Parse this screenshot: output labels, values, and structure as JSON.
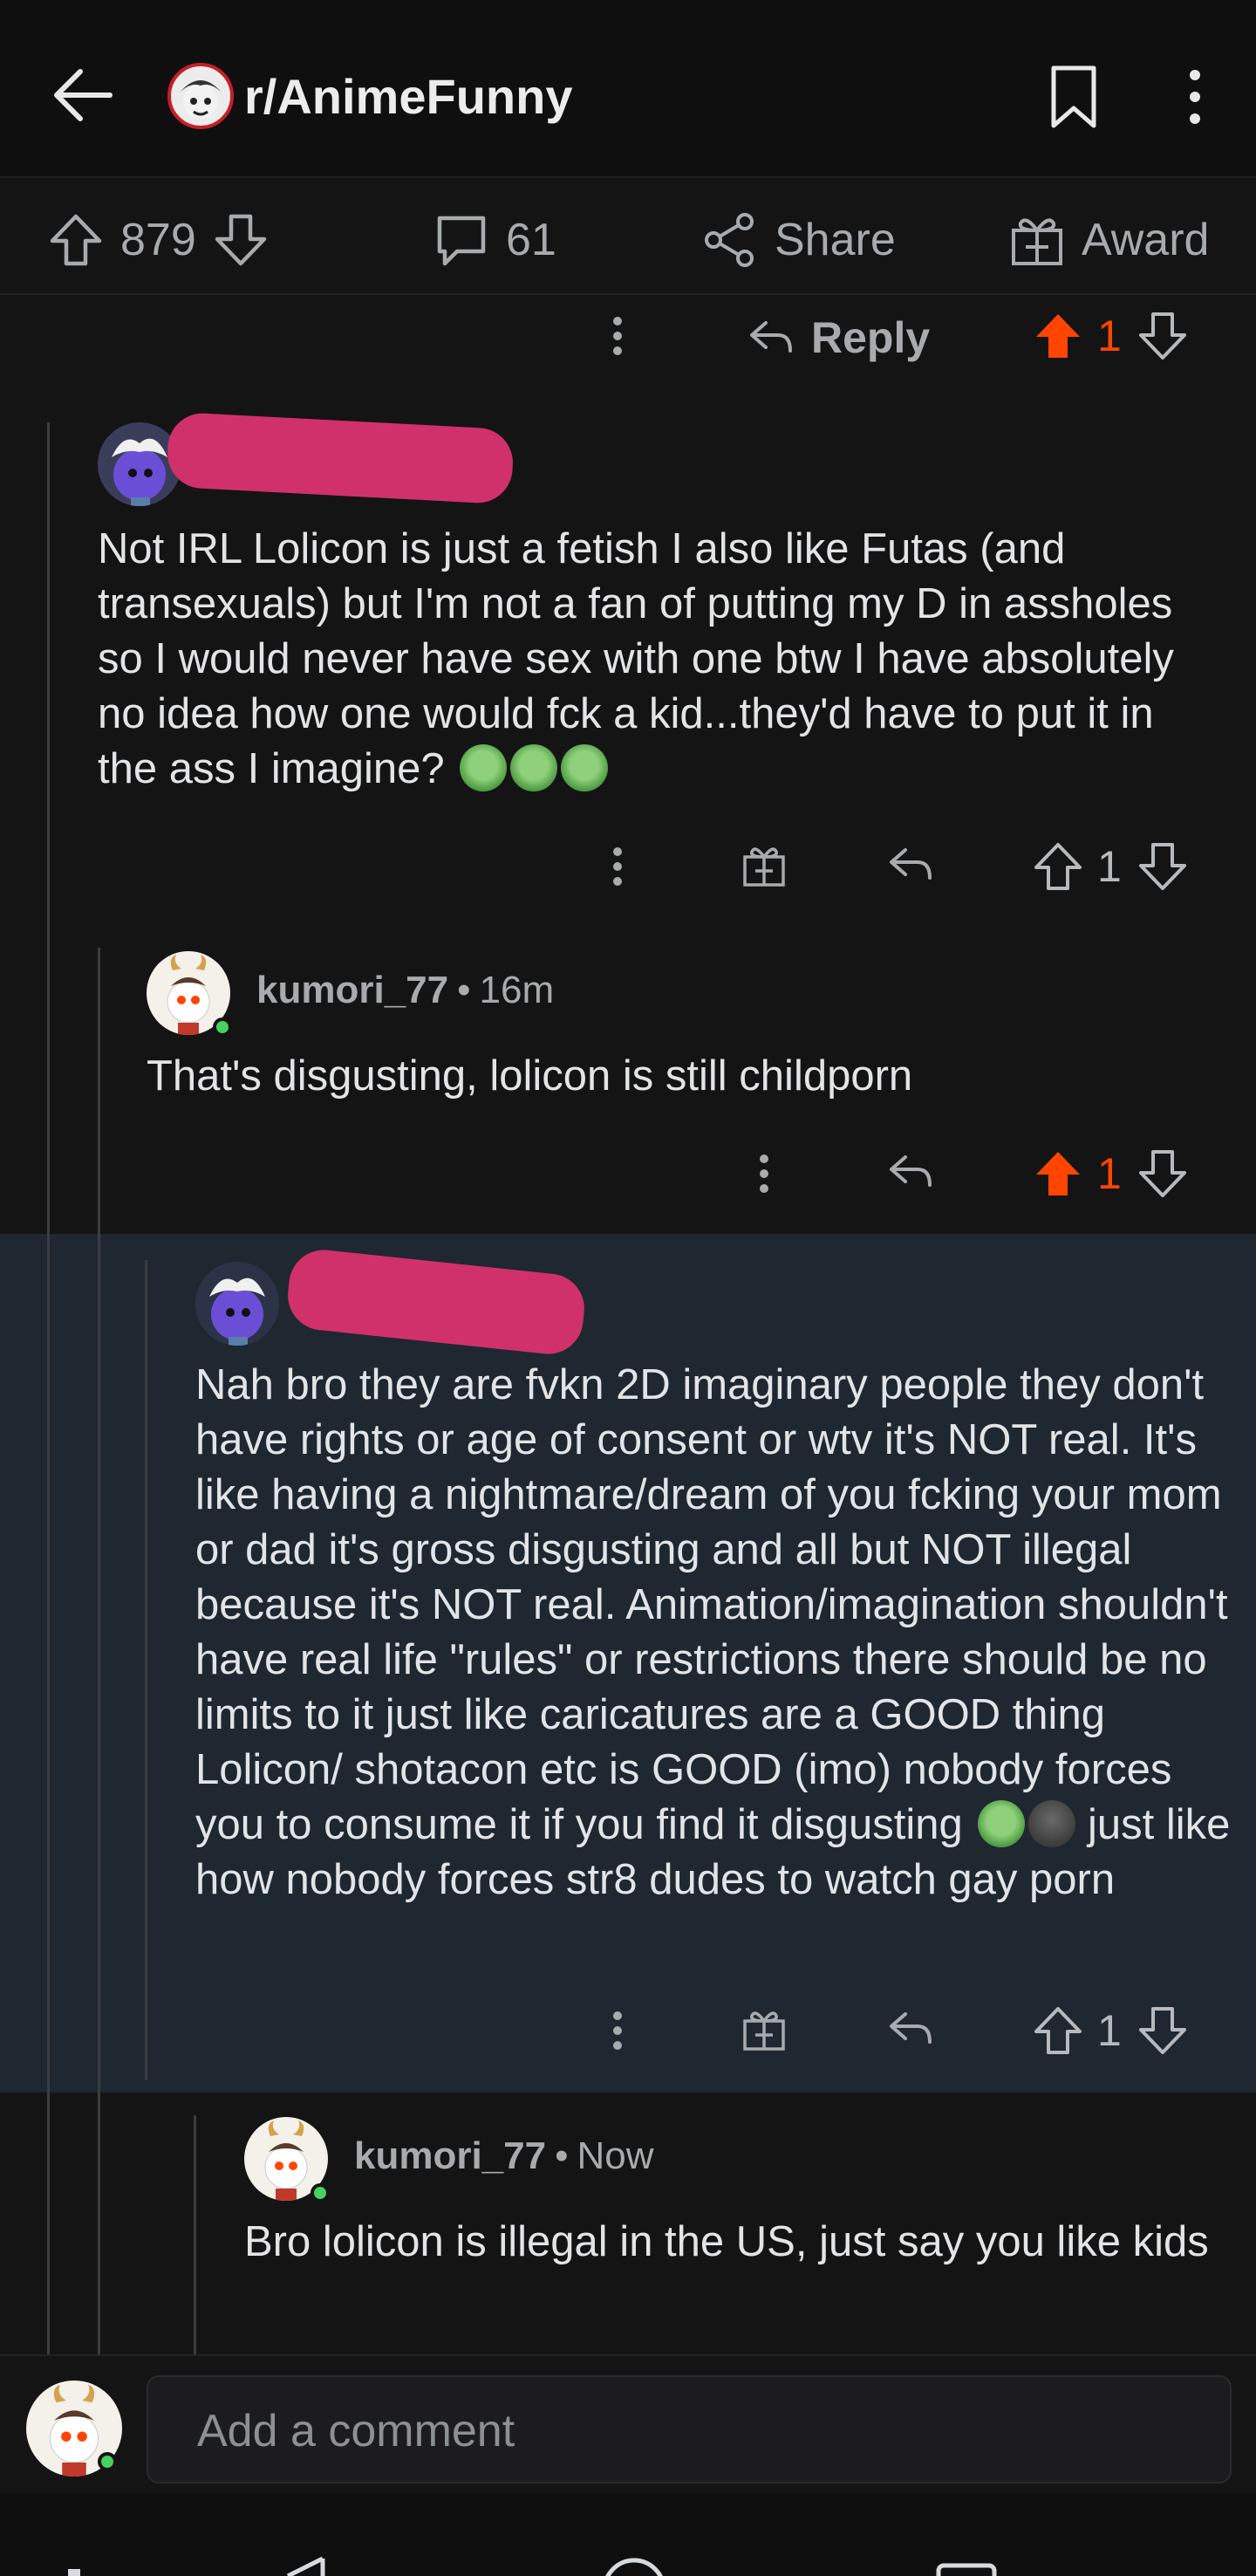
{
  "header": {
    "subreddit": "r/AnimeFunny"
  },
  "action_bar": {
    "votes": "879",
    "comments": "61",
    "share": "Share",
    "award": "Award"
  },
  "top_row": {
    "reply": "Reply",
    "score": "1"
  },
  "comments": [
    {
      "text": "Not IRL Lolicon is just a fetish I also like Futas (and transexuals) but I'm not a fan of putting my D in assholes so I would never have sex with one btw I have absolutely no idea how one would fck a kid...they'd have to put it in the ass I imagine?",
      "score": "1"
    },
    {
      "user": "kumori_77",
      "time": "16m",
      "text": "That's disgusting, lolicon is still childporn",
      "score": "1"
    },
    {
      "text_before_emoji": "Nah bro they are fvkn 2D imaginary people they don't have rights or age of consent or wtv it's NOT real. It's like having a nightmare/dream of you fcking your mom or dad it's gross disgusting and all but NOT illegal because it's NOT real. Animation/imagination shouldn't have real life \"rules\" or restrictions there should be no limits to it just like caricatures are a GOOD thing Lolicon/ shotacon etc is GOOD (imo) nobody forces you to consume it if you find it disgusting",
      "text_after_emoji": "just like how nobody forces str8 dudes to watch gay porn",
      "score": "1"
    },
    {
      "user": "kumori_77",
      "time": "Now",
      "text": "Bro lolicon is illegal in the US, just say you like kids"
    }
  ],
  "composer": {
    "placeholder": "Add a comment"
  },
  "colors": {
    "upvote_active": "#ff4500",
    "highlight_bg": "#1f2731",
    "redaction": "#d0316a"
  },
  "icons": [
    "back-arrow-icon",
    "bookmark-icon",
    "more-vertical-icon",
    "upvote-icon",
    "downvote-icon",
    "comment-bubble-icon",
    "share-icon",
    "award-gift-icon",
    "reply-icon"
  ]
}
